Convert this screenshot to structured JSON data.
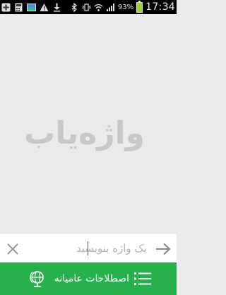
{
  "status_bar": {
    "time": "17:34",
    "battery_percent": "93%",
    "battery_level": 0.93
  },
  "app": {
    "logo_text": "واژه‌یاب"
  },
  "search": {
    "placeholder": "یک واژه بنویسید",
    "value": ""
  },
  "bottom_bar": {
    "label": "اصطلاحات عامیانه"
  },
  "colors": {
    "accent_green": "#27b14c",
    "background": "#ebebeb",
    "logo_gray": "#c8c8c8"
  }
}
